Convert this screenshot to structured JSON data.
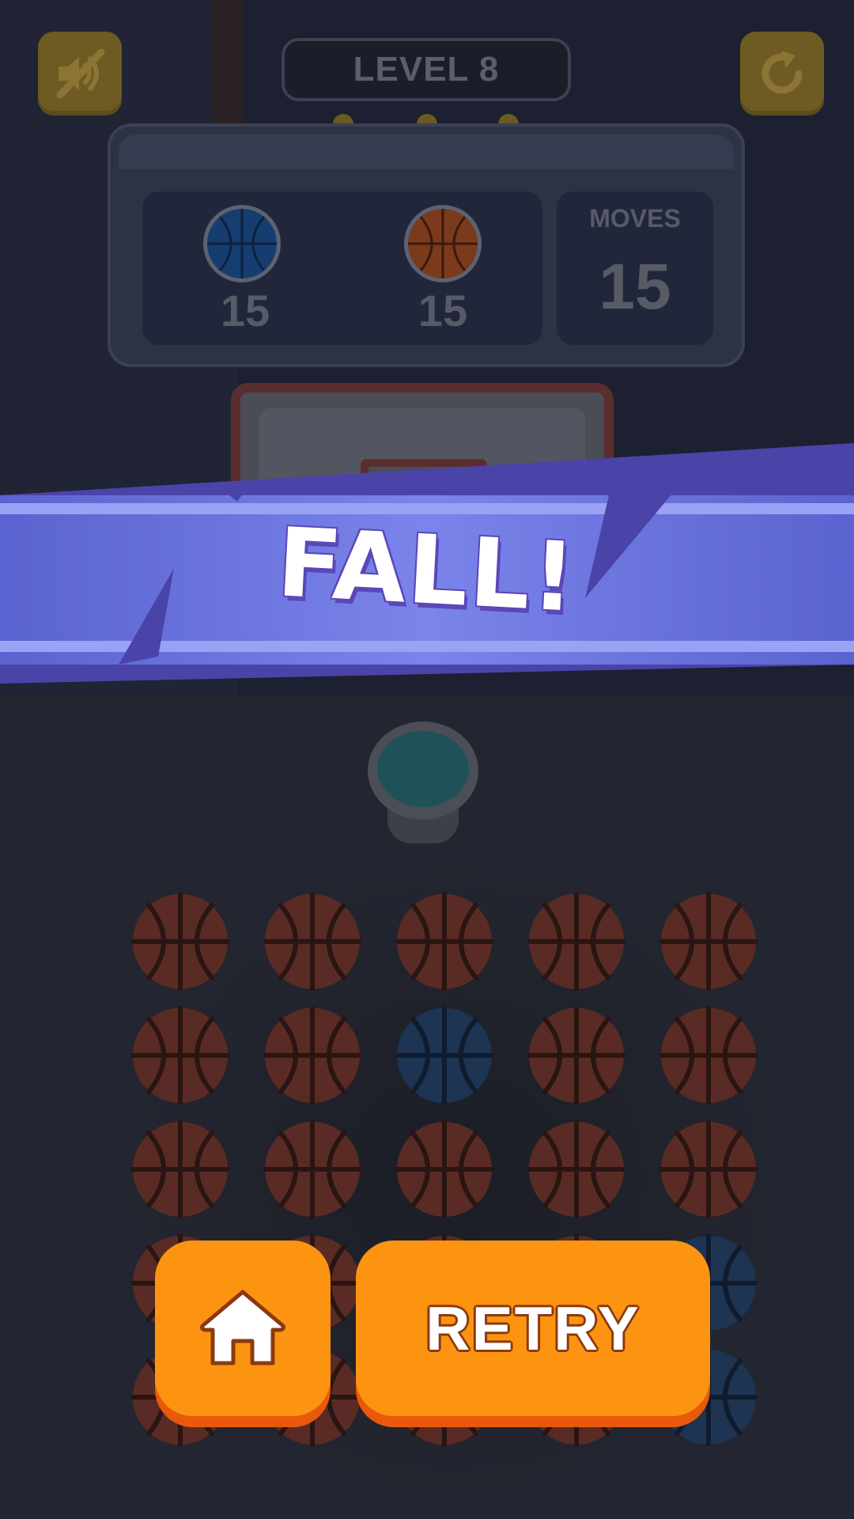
{
  "hud": {
    "level_label": "LEVEL 8",
    "mute_icon": "speaker-muted-icon",
    "restart_icon": "restart-icon"
  },
  "scoreboard": {
    "teams": [
      {
        "ball": "blue-basketball",
        "count": "15"
      },
      {
        "ball": "orange-basketball",
        "count": "15"
      }
    ],
    "moves_label": "MOVES",
    "moves_value": "15"
  },
  "banner": {
    "text": "FALL!"
  },
  "grid": {
    "rows": [
      [
        "orange",
        "orange",
        "orange",
        "orange",
        "orange"
      ],
      [
        "orange",
        "orange",
        "blue",
        "orange",
        "orange"
      ],
      [
        "orange",
        "orange",
        "orange",
        "orange",
        "orange"
      ],
      [
        "orange",
        "orange",
        "orange",
        "orange",
        "blue"
      ],
      [
        "orange",
        "orange",
        "orange",
        "orange",
        "blue"
      ]
    ]
  },
  "actions": {
    "home_icon": "home-icon",
    "retry_label": "RETRY"
  },
  "colors": {
    "accent": "#fd9411",
    "accent_shadow": "#e8590b",
    "banner": "#6f7ee0",
    "ball_orange": "#5a2b25",
    "ball_blue": "#1d3452"
  }
}
